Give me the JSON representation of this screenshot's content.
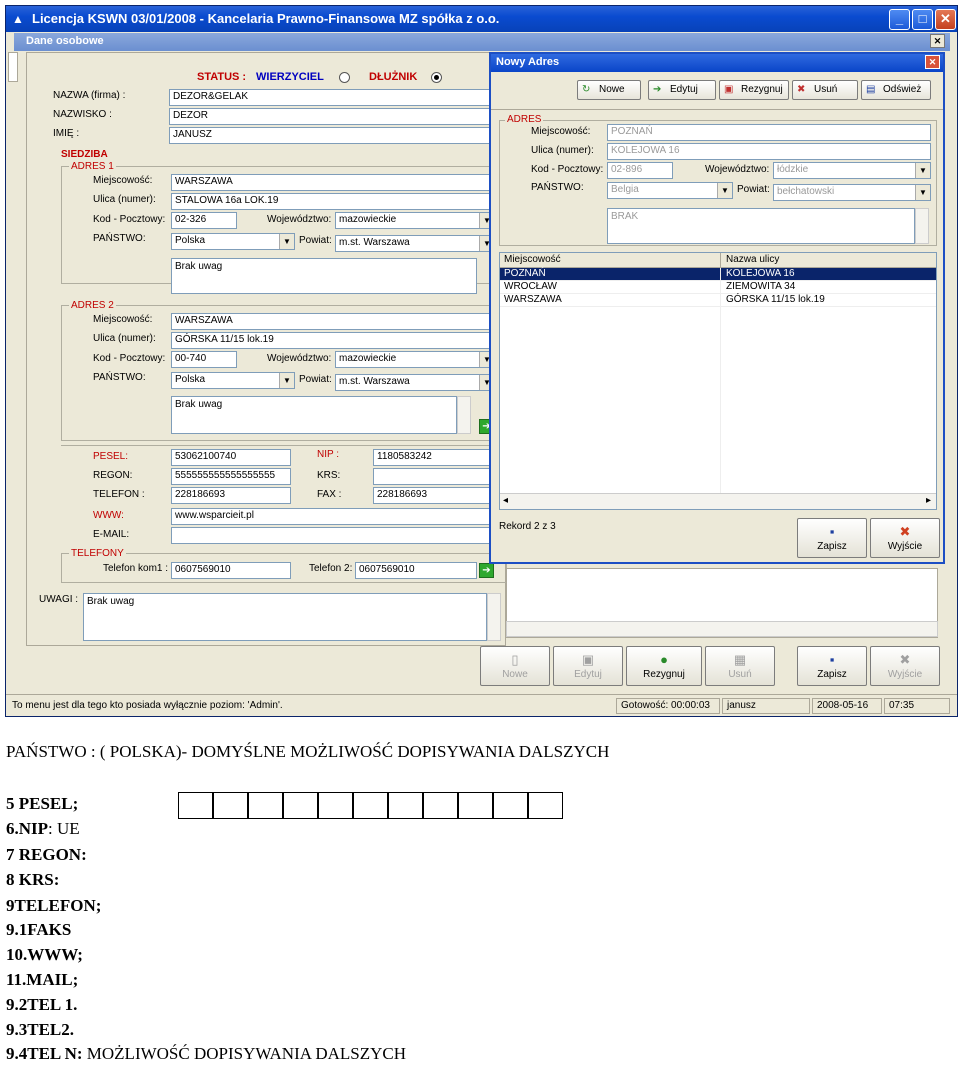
{
  "window": {
    "title": "Licencja KSWN 03/01/2008 - Kancelaria Prawno-Finansowa MZ spółka z o.o.",
    "min": "_",
    "max": "□",
    "close": "✕",
    "mdi_title": "Dane osobowe",
    "mdi_close": "✕"
  },
  "form": {
    "status_label": "STATUS :",
    "wierzyciel": "WIERZYCIEL",
    "dluznik": "DŁUŻNIK",
    "nazwa_label": "NAZWA (firma) :",
    "nazwa": "DEZOR&GELAK",
    "nazwisko_label": "NAZWISKO :",
    "nazwisko": "DEZOR",
    "imie_label": "IMIĘ :",
    "imie": "JANUSZ",
    "siedziba": "SIEDZIBA",
    "adres1_title": "ADRES 1",
    "adres2_title": "ADRES 2",
    "miejscowosc_label": "Miejscowość:",
    "ulica_label": "Ulica (numer):",
    "kod_label": "Kod - Pocztowy:",
    "woj_label": "Województwo:",
    "panstwo_label": "PAŃSTWO:",
    "powiat_label": "Powiat:",
    "a1_miejsc": "WARSZAWA",
    "a1_ulica": "STALOWA 16a LOK.19",
    "a1_kod": "02-326",
    "a1_woj": "mazowieckie",
    "a1_panstwo": "Polska",
    "a1_powiat": "m.st. Warszawa",
    "a1_uwagi": "Brak uwag",
    "a2_miejsc": "WARSZAWA",
    "a2_ulica": "GÓRSKA 11/15 lok.19",
    "a2_kod": "00-740",
    "a2_woj": "mazowieckie",
    "a2_panstwo": "Polska",
    "a2_powiat": "m.st. Warszawa",
    "a2_uwagi": "Brak uwag",
    "pesel_label": "PESEL:",
    "pesel": "53062100740",
    "nip_label": "NIP :",
    "nip": "1180583242",
    "regon_label": "REGON:",
    "regon": "555555555555555555",
    "krs_label": "KRS:",
    "krs": "",
    "telefon_label": "TELEFON :",
    "telefon": "228186693",
    "fax_label": "FAX :",
    "fax": "228186693",
    "www_label": "WWW:",
    "www": "www.wsparcieit.pl",
    "email_label": "E-MAIL:",
    "email": "",
    "telefony_title": "TELEFONY",
    "tel1_label": "Telefon kom1 :",
    "tel1": "0607569010",
    "tel2_label": "Telefon 2:",
    "tel2": "0607569010",
    "uwagi_label": "UWAGI :",
    "uwagi": "Brak uwag"
  },
  "bottom_buttons": {
    "nowe": "Nowe",
    "edytuj": "Edytuj",
    "rezygnuj": "Rezygnuj",
    "usun": "Usuń",
    "zapisz": "Zapisz",
    "wyjscie": "Wyjście"
  },
  "status": {
    "msg": "To menu jest dla tego kto posiada wyłącznie poziom: 'Admin'.",
    "gotowosc": "Gotowość: 00:00:03",
    "user": "janusz",
    "date": "2008-05-16",
    "time": "07:35"
  },
  "dialog": {
    "title": "Nowy Adres",
    "close": "✕",
    "toolbar": {
      "nowe": "Nowe",
      "edytuj": "Edytuj",
      "rezygnuj": "Rezygnuj",
      "usun": "Usuń",
      "odswiez": "Odśwież"
    },
    "adres_title": "ADRES",
    "miejscowosc_label": "Miejscowość:",
    "ulica_label": "Ulica (numer):",
    "kod_label": "Kod - Pocztowy:",
    "woj_label": "Województwo:",
    "panstwo_label": "PAŃSTWO:",
    "powiat_label": "Powiat:",
    "miejsc": "POZNAŃ",
    "ulica": "KOLEJOWA 16",
    "kod": "02-896",
    "woj": "łódzkie",
    "panstwo": "Belgia",
    "powiat": "bełchatowski",
    "uwagi": "BRAK",
    "grid_headers": [
      "Miejscowość",
      "Nazwa ulicy"
    ],
    "grid_rows": [
      [
        "POZNAŃ",
        "KOLEJOWA 16"
      ],
      [
        "WROCŁAW",
        "ZIEMOWITA 34"
      ],
      [
        "WARSZAWA",
        "GÓRSKA 11/15 lok.19"
      ]
    ],
    "rekord": "Rekord 2 z 3",
    "zapisz": "Zapisz",
    "wyjscie": "Wyjście"
  },
  "doc": {
    "line1": "PAŃSTWO : ( POLSKA)- DOMYŚLNE  MOŻLIWOŚĆ DOPISYWANIA DALSZYCH",
    "pesel": "5 PESEL;",
    "nip_bold": "6.NIP",
    "nip_rest": ": UE",
    "regon": "7 REGON:",
    "krs": "8 KRS:",
    "telefon": "9TELEFON;",
    "faks": "9.1FAKS",
    "www": "10.WWW;",
    "mail": "11.MAIL;",
    "tel1": "9.2TEL 1.",
    "tel2": "9.3TEL2.",
    "teln_bold": "9.4TEL N:",
    "teln_rest": " MOŻLIWOŚĆ DOPISYWANIA DALSZYCH",
    "pesel_boxes": 11
  }
}
